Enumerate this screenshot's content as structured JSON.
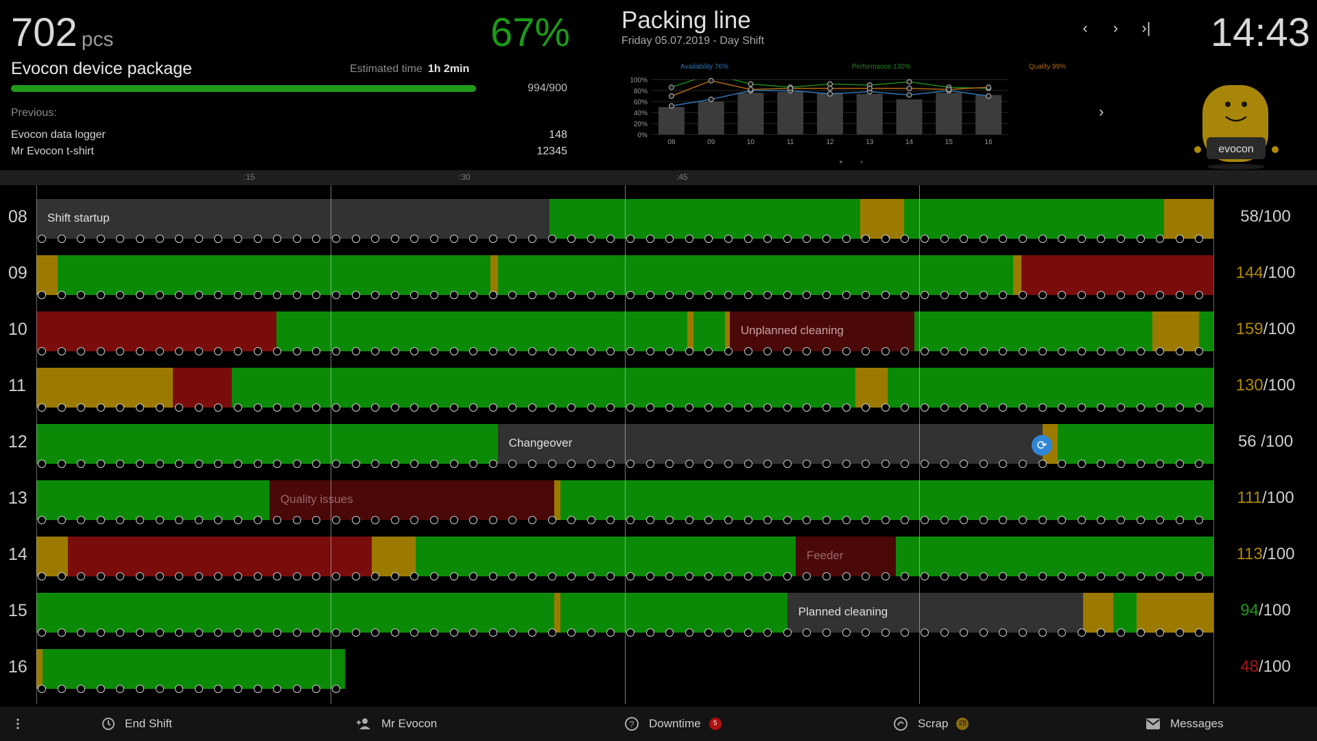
{
  "production": {
    "count": "702",
    "unit": "pcs",
    "oee": "67%",
    "product": "Evocon device package",
    "estimated_label": "Estimated time",
    "estimated_value": "1h 2min",
    "progress_fraction": 1.0,
    "progress_text": "994/900",
    "previous_label": "Previous:",
    "previous": [
      {
        "name": "Evocon data logger",
        "qty": "148"
      },
      {
        "name": "Mr Evocon t-shirt",
        "qty": "12345"
      }
    ]
  },
  "line": {
    "title": "Packing line",
    "subtitle": "Friday 05.07.2019 - Day Shift"
  },
  "nav": {
    "prev": "‹",
    "next": "›",
    "last": "›|"
  },
  "clock": "14:43",
  "chart_next": "›",
  "colors": {
    "green": "#0b8a08",
    "yellow": "#9c7a00",
    "red": "#7a0c0c",
    "darkred": "#4a0808",
    "grey": "#323232",
    "availability": "#2e77b5",
    "performance": "#1c8a18",
    "quality": "#b36a16"
  },
  "chart_data": {
    "type": "bar",
    "categories": [
      "08",
      "09",
      "10",
      "11",
      "12",
      "13",
      "14",
      "15",
      "16"
    ],
    "values": [
      50,
      60,
      76,
      78,
      76,
      74,
      64,
      76,
      72
    ],
    "ylim": [
      0,
      100
    ],
    "yticks": [
      "100%",
      "80%",
      "60%",
      "40%",
      "20%",
      "0%"
    ],
    "legend": [
      "Availability 76%",
      "Performance 130%",
      "Quality 99%"
    ],
    "series": [
      {
        "name": "Availability 76%",
        "values": [
          52,
          64,
          80,
          80,
          74,
          78,
          72,
          80,
          70
        ]
      },
      {
        "name": "Performance 130%",
        "values": [
          86,
          110,
          92,
          86,
          92,
          90,
          96,
          86,
          84
        ]
      },
      {
        "name": "Quality 99%",
        "values": [
          70,
          98,
          82,
          84,
          84,
          84,
          84,
          82,
          86
        ]
      }
    ]
  },
  "ruler": [
    ":15",
    ":30",
    ":45"
  ],
  "timeline": [
    {
      "hour": "08",
      "num": "58",
      "den": "/100",
      "num_color": "#cfcfcf",
      "segments": [
        {
          "from": 0,
          "to": 0.436,
          "color": "grey",
          "label": "Shift startup",
          "label_color": "#e0e0e0"
        },
        {
          "from": 0.436,
          "to": 0.7,
          "color": "green"
        },
        {
          "from": 0.7,
          "to": 0.737,
          "color": "yellow"
        },
        {
          "from": 0.737,
          "to": 0.958,
          "color": "green"
        },
        {
          "from": 0.958,
          "to": 1.0,
          "color": "yellow"
        }
      ]
    },
    {
      "hour": "09",
      "num": "144",
      "den": "/100",
      "num_color": "#b08a00",
      "segments": [
        {
          "from": 0,
          "to": 0.018,
          "color": "yellow"
        },
        {
          "from": 0.018,
          "to": 0.386,
          "color": "green"
        },
        {
          "from": 0.386,
          "to": 0.392,
          "color": "yellow"
        },
        {
          "from": 0.392,
          "to": 0.83,
          "color": "green"
        },
        {
          "from": 0.83,
          "to": 0.837,
          "color": "yellow"
        },
        {
          "from": 0.837,
          "to": 1.0,
          "color": "red"
        }
      ]
    },
    {
      "hour": "10",
      "num": "159",
      "den": "/100",
      "num_color": "#b08a00",
      "segments": [
        {
          "from": 0,
          "to": 0.204,
          "color": "red"
        },
        {
          "from": 0.204,
          "to": 0.553,
          "color": "green"
        },
        {
          "from": 0.553,
          "to": 0.558,
          "color": "yellow"
        },
        {
          "from": 0.558,
          "to": 0.585,
          "color": "green"
        },
        {
          "from": 0.585,
          "to": 0.589,
          "color": "yellow"
        },
        {
          "from": 0.589,
          "to": 0.746,
          "color": "darkred",
          "label": "Unplanned cleaning",
          "label_color": "#c9a3a3"
        },
        {
          "from": 0.746,
          "to": 0.948,
          "color": "green"
        },
        {
          "from": 0.948,
          "to": 0.988,
          "color": "yellow"
        },
        {
          "from": 0.988,
          "to": 1.0,
          "color": "green"
        }
      ]
    },
    {
      "hour": "11",
      "num": "130",
      "den": "/100",
      "num_color": "#b08a00",
      "segments": [
        {
          "from": 0,
          "to": 0.116,
          "color": "yellow"
        },
        {
          "from": 0.116,
          "to": 0.166,
          "color": "red"
        },
        {
          "from": 0.166,
          "to": 0.696,
          "color": "green"
        },
        {
          "from": 0.696,
          "to": 0.723,
          "color": "yellow"
        },
        {
          "from": 0.723,
          "to": 1.0,
          "color": "green"
        }
      ]
    },
    {
      "hour": "12",
      "num": "56",
      "den": " /100",
      "num_color": "#cfcfcf",
      "segments": [
        {
          "from": 0,
          "to": 0.392,
          "color": "green"
        },
        {
          "from": 0.392,
          "to": 0.855,
          "color": "grey",
          "label": "Changeover",
          "label_color": "#e0e0e0"
        },
        {
          "from": 0.855,
          "to": 0.868,
          "color": "yellow"
        },
        {
          "from": 0.868,
          "to": 1.0,
          "color": "green"
        }
      ]
    },
    {
      "hour": "13",
      "num": "111",
      "den": "/100",
      "num_color": "#b08a00",
      "segments": [
        {
          "from": 0,
          "to": 0.198,
          "color": "green"
        },
        {
          "from": 0.198,
          "to": 0.44,
          "color": "darkred",
          "label": "Quality issues",
          "label_color": "#9a6a6a"
        },
        {
          "from": 0.44,
          "to": 0.445,
          "color": "yellow"
        },
        {
          "from": 0.445,
          "to": 1.0,
          "color": "green"
        }
      ]
    },
    {
      "hour": "14",
      "num": "113",
      "den": "/100",
      "num_color": "#b08a00",
      "segments": [
        {
          "from": 0,
          "to": 0.027,
          "color": "yellow"
        },
        {
          "from": 0.027,
          "to": 0.285,
          "color": "red"
        },
        {
          "from": 0.285,
          "to": 0.322,
          "color": "yellow"
        },
        {
          "from": 0.322,
          "to": 0.645,
          "color": "green"
        },
        {
          "from": 0.645,
          "to": 0.73,
          "color": "darkred",
          "label": "Feeder",
          "label_color": "#9a6a6a"
        },
        {
          "from": 0.73,
          "to": 1.0,
          "color": "green"
        }
      ]
    },
    {
      "hour": "15",
      "num": "94",
      "den": "/100",
      "num_color": "#1c9a18",
      "segments": [
        {
          "from": 0,
          "to": 0.44,
          "color": "green"
        },
        {
          "from": 0.44,
          "to": 0.445,
          "color": "yellow"
        },
        {
          "from": 0.445,
          "to": 0.638,
          "color": "green"
        },
        {
          "from": 0.638,
          "to": 0.889,
          "color": "grey",
          "label": "Planned cleaning",
          "label_color": "#e0e0e0"
        },
        {
          "from": 0.889,
          "to": 0.915,
          "color": "yellow"
        },
        {
          "from": 0.915,
          "to": 0.935,
          "color": "green"
        },
        {
          "from": 0.935,
          "to": 1.0,
          "color": "yellow"
        }
      ]
    },
    {
      "hour": "16",
      "num": "48",
      "den": "/100",
      "num_color": "#a51818",
      "segments": [
        {
          "from": 0,
          "to": 0.005,
          "color": "yellow"
        },
        {
          "from": 0.005,
          "to": 0.262,
          "color": "green"
        }
      ]
    }
  ],
  "footer": {
    "end_shift": "End Shift",
    "operator": "Mr Evocon",
    "downtime": "Downtime",
    "downtime_count": "5",
    "scrap": "Scrap",
    "scrap_count": "25",
    "messages": "Messages"
  },
  "mascot_text": "evocon"
}
